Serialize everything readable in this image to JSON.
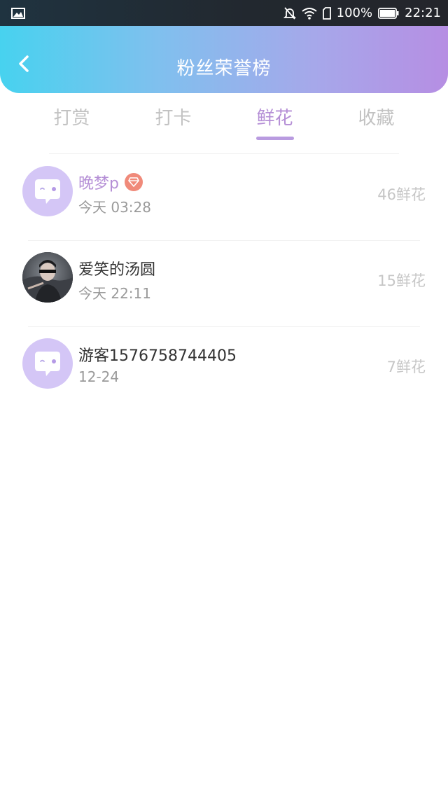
{
  "status_bar": {
    "battery": "100%",
    "time": "22:21",
    "icons": [
      "image-icon",
      "mute-icon",
      "wifi-icon",
      "sim-icon",
      "battery-icon"
    ]
  },
  "header": {
    "title": "粉丝荣誉榜",
    "back_icon": "back-arrow-icon",
    "gradient_colors": [
      "#47d2ef",
      "#b68ee3"
    ]
  },
  "tabs": [
    {
      "label": "打赏",
      "active": false
    },
    {
      "label": "打卡",
      "active": false
    },
    {
      "label": "鲜花",
      "active": true
    },
    {
      "label": "收藏",
      "active": false
    }
  ],
  "colors": {
    "accent": "#b58fd6",
    "secondary_text": "#9a9a9a",
    "amount_text": "#c6c6c6"
  },
  "list": [
    {
      "name": "晚梦p",
      "time": "今天 03:28",
      "amount": "46鲜花",
      "avatar": "default-chat-avatar",
      "vip": true
    },
    {
      "name": "爱笑的汤圆",
      "time": "今天 22:11",
      "amount": "15鲜花",
      "avatar": "photo-avatar",
      "vip": false
    },
    {
      "name": "游客1576758744405",
      "time": "12-24",
      "amount": "7鲜花",
      "avatar": "default-chat-avatar",
      "vip": false
    }
  ]
}
